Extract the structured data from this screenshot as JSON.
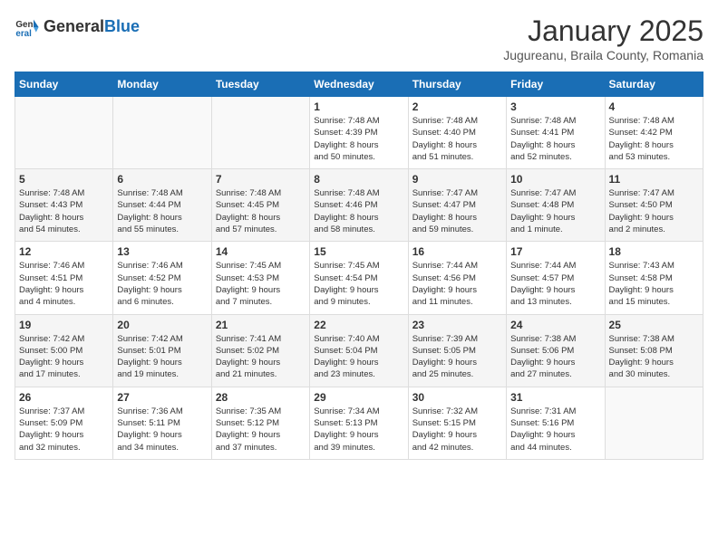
{
  "header": {
    "logo_general": "General",
    "logo_blue": "Blue",
    "month": "January 2025",
    "location": "Jugureanu, Braila County, Romania"
  },
  "days_of_week": [
    "Sunday",
    "Monday",
    "Tuesday",
    "Wednesday",
    "Thursday",
    "Friday",
    "Saturday"
  ],
  "weeks": [
    [
      {
        "day": "",
        "info": ""
      },
      {
        "day": "",
        "info": ""
      },
      {
        "day": "",
        "info": ""
      },
      {
        "day": "1",
        "info": "Sunrise: 7:48 AM\nSunset: 4:39 PM\nDaylight: 8 hours\nand 50 minutes."
      },
      {
        "day": "2",
        "info": "Sunrise: 7:48 AM\nSunset: 4:40 PM\nDaylight: 8 hours\nand 51 minutes."
      },
      {
        "day": "3",
        "info": "Sunrise: 7:48 AM\nSunset: 4:41 PM\nDaylight: 8 hours\nand 52 minutes."
      },
      {
        "day": "4",
        "info": "Sunrise: 7:48 AM\nSunset: 4:42 PM\nDaylight: 8 hours\nand 53 minutes."
      }
    ],
    [
      {
        "day": "5",
        "info": "Sunrise: 7:48 AM\nSunset: 4:43 PM\nDaylight: 8 hours\nand 54 minutes."
      },
      {
        "day": "6",
        "info": "Sunrise: 7:48 AM\nSunset: 4:44 PM\nDaylight: 8 hours\nand 55 minutes."
      },
      {
        "day": "7",
        "info": "Sunrise: 7:48 AM\nSunset: 4:45 PM\nDaylight: 8 hours\nand 57 minutes."
      },
      {
        "day": "8",
        "info": "Sunrise: 7:48 AM\nSunset: 4:46 PM\nDaylight: 8 hours\nand 58 minutes."
      },
      {
        "day": "9",
        "info": "Sunrise: 7:47 AM\nSunset: 4:47 PM\nDaylight: 8 hours\nand 59 minutes."
      },
      {
        "day": "10",
        "info": "Sunrise: 7:47 AM\nSunset: 4:48 PM\nDaylight: 9 hours\nand 1 minute."
      },
      {
        "day": "11",
        "info": "Sunrise: 7:47 AM\nSunset: 4:50 PM\nDaylight: 9 hours\nand 2 minutes."
      }
    ],
    [
      {
        "day": "12",
        "info": "Sunrise: 7:46 AM\nSunset: 4:51 PM\nDaylight: 9 hours\nand 4 minutes."
      },
      {
        "day": "13",
        "info": "Sunrise: 7:46 AM\nSunset: 4:52 PM\nDaylight: 9 hours\nand 6 minutes."
      },
      {
        "day": "14",
        "info": "Sunrise: 7:45 AM\nSunset: 4:53 PM\nDaylight: 9 hours\nand 7 minutes."
      },
      {
        "day": "15",
        "info": "Sunrise: 7:45 AM\nSunset: 4:54 PM\nDaylight: 9 hours\nand 9 minutes."
      },
      {
        "day": "16",
        "info": "Sunrise: 7:44 AM\nSunset: 4:56 PM\nDaylight: 9 hours\nand 11 minutes."
      },
      {
        "day": "17",
        "info": "Sunrise: 7:44 AM\nSunset: 4:57 PM\nDaylight: 9 hours\nand 13 minutes."
      },
      {
        "day": "18",
        "info": "Sunrise: 7:43 AM\nSunset: 4:58 PM\nDaylight: 9 hours\nand 15 minutes."
      }
    ],
    [
      {
        "day": "19",
        "info": "Sunrise: 7:42 AM\nSunset: 5:00 PM\nDaylight: 9 hours\nand 17 minutes."
      },
      {
        "day": "20",
        "info": "Sunrise: 7:42 AM\nSunset: 5:01 PM\nDaylight: 9 hours\nand 19 minutes."
      },
      {
        "day": "21",
        "info": "Sunrise: 7:41 AM\nSunset: 5:02 PM\nDaylight: 9 hours\nand 21 minutes."
      },
      {
        "day": "22",
        "info": "Sunrise: 7:40 AM\nSunset: 5:04 PM\nDaylight: 9 hours\nand 23 minutes."
      },
      {
        "day": "23",
        "info": "Sunrise: 7:39 AM\nSunset: 5:05 PM\nDaylight: 9 hours\nand 25 minutes."
      },
      {
        "day": "24",
        "info": "Sunrise: 7:38 AM\nSunset: 5:06 PM\nDaylight: 9 hours\nand 27 minutes."
      },
      {
        "day": "25",
        "info": "Sunrise: 7:38 AM\nSunset: 5:08 PM\nDaylight: 9 hours\nand 30 minutes."
      }
    ],
    [
      {
        "day": "26",
        "info": "Sunrise: 7:37 AM\nSunset: 5:09 PM\nDaylight: 9 hours\nand 32 minutes."
      },
      {
        "day": "27",
        "info": "Sunrise: 7:36 AM\nSunset: 5:11 PM\nDaylight: 9 hours\nand 34 minutes."
      },
      {
        "day": "28",
        "info": "Sunrise: 7:35 AM\nSunset: 5:12 PM\nDaylight: 9 hours\nand 37 minutes."
      },
      {
        "day": "29",
        "info": "Sunrise: 7:34 AM\nSunset: 5:13 PM\nDaylight: 9 hours\nand 39 minutes."
      },
      {
        "day": "30",
        "info": "Sunrise: 7:32 AM\nSunset: 5:15 PM\nDaylight: 9 hours\nand 42 minutes."
      },
      {
        "day": "31",
        "info": "Sunrise: 7:31 AM\nSunset: 5:16 PM\nDaylight: 9 hours\nand 44 minutes."
      },
      {
        "day": "",
        "info": ""
      }
    ]
  ]
}
